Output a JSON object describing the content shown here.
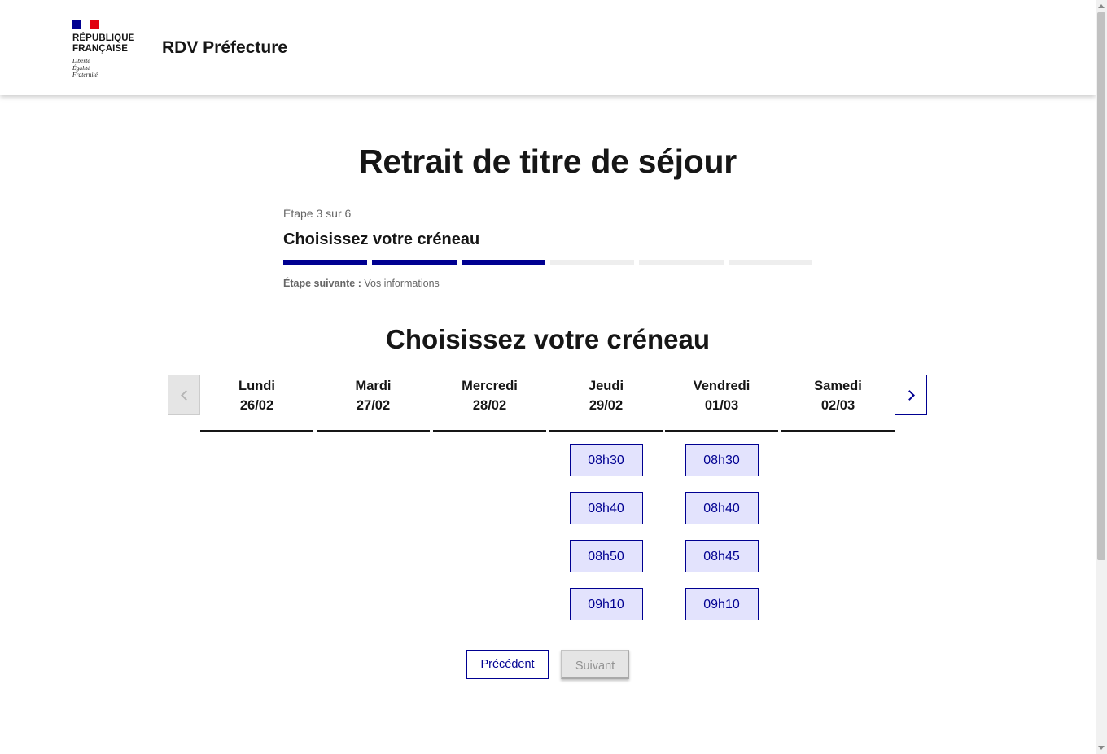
{
  "header": {
    "logo_line1": "RÉPUBLIQUE",
    "logo_line2": "FRANÇAISE",
    "motto1": "Liberté",
    "motto2": "Égalité",
    "motto3": "Fraternité",
    "site_title": "RDV Préfecture"
  },
  "page_title": "Retrait de titre de séjour",
  "stepper": {
    "count": "Étape 3 sur 6",
    "title": "Choisissez votre créneau",
    "total_steps": 6,
    "current_step": 3,
    "next_label": "Étape suivante :",
    "next_value": "Vos informations"
  },
  "section_title": "Choisissez votre créneau",
  "calendar": {
    "days": [
      {
        "name": "Lundi",
        "date": "26/02",
        "slots": []
      },
      {
        "name": "Mardi",
        "date": "27/02",
        "slots": []
      },
      {
        "name": "Mercredi",
        "date": "28/02",
        "slots": []
      },
      {
        "name": "Jeudi",
        "date": "29/02",
        "slots": [
          "08h30",
          "08h40",
          "08h50",
          "09h10"
        ]
      },
      {
        "name": "Vendredi",
        "date": "01/03",
        "slots": [
          "08h30",
          "08h40",
          "08h45",
          "09h10"
        ]
      },
      {
        "name": "Samedi",
        "date": "02/03",
        "slots": []
      }
    ],
    "prev_icon": "chevron-left-icon",
    "next_icon": "chevron-right-icon"
  },
  "buttons": {
    "previous": "Précédent",
    "next": "Suivant"
  },
  "colors": {
    "primary": "#000091",
    "slot_bg": "#e3e3fd",
    "flag_blue": "#000091",
    "flag_red": "#e1000f"
  }
}
